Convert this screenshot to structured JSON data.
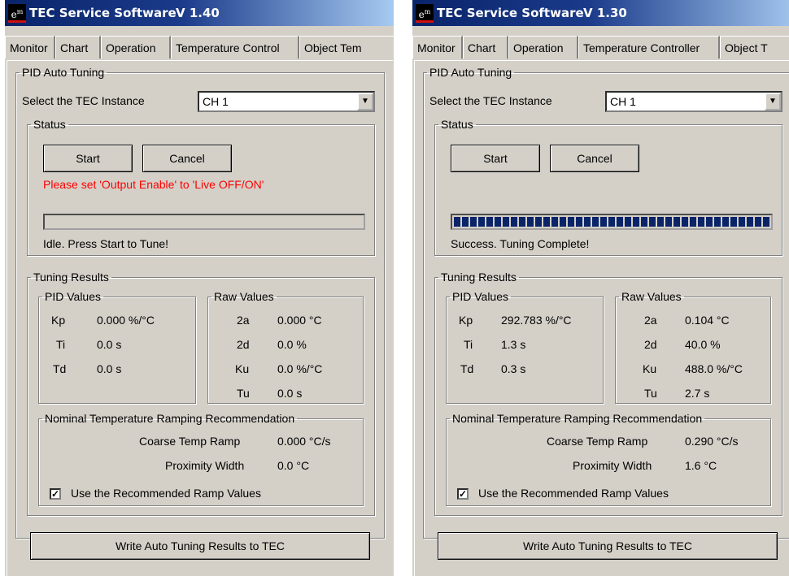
{
  "windows": [
    {
      "title": "TEC Service Software",
      "version": "V 1.40",
      "tabs": [
        "Monitor",
        "Chart",
        "Operation",
        "Temperature Control",
        "Object Tem"
      ],
      "pid_auto_tuning": "PID Auto Tuning",
      "select_label": "Select the TEC Instance",
      "instance_value": "CH 1",
      "status_legend": "Status",
      "start_label": "Start",
      "cancel_label": "Cancel",
      "warning": "Please set 'Output Enable' to 'Live OFF/ON'",
      "progress": 0,
      "status_message": "Idle. Press Start to Tune!",
      "tuning_results": "Tuning Results",
      "pid_values_legend": "PID Values",
      "pid": {
        "kp_label": "Kp",
        "kp_value": "0.000 %/°C",
        "ti_label": "Ti",
        "ti_value": "0.0 s",
        "td_label": "Td",
        "td_value": "0.0 s"
      },
      "raw_values_legend": "Raw Values",
      "raw": {
        "a2_label": "2a",
        "a2_value": "0.000 °C",
        "d2_label": "2d",
        "d2_value": "0.0 %",
        "ku_label": "Ku",
        "ku_value": "0.0 %/°C",
        "tu_label": "Tu",
        "tu_value": "0.0 s"
      },
      "ramp_legend": "Nominal Temperature Ramping Recommendation",
      "coarse_label": "Coarse Temp Ramp",
      "coarse_value": "0.000 °C/s",
      "proximity_label": "Proximity Width",
      "proximity_value": "0.0 °C",
      "use_recommended": "Use the Recommended Ramp Values",
      "use_checked": "✓",
      "write_button": "Write Auto Tuning Results to TEC"
    },
    {
      "title": "TEC Service Software",
      "version": "V 1.30",
      "tabs": [
        "Monitor",
        "Chart",
        "Operation",
        "Temperature Controller",
        "Object T"
      ],
      "pid_auto_tuning": "PID Auto Tuning",
      "select_label": "Select the TEC Instance",
      "instance_value": "CH 1",
      "status_legend": "Status",
      "start_label": "Start",
      "cancel_label": "Cancel",
      "warning": "",
      "progress": 1.0,
      "status_message": "Success. Tuning Complete!",
      "tuning_results": "Tuning Results",
      "pid_values_legend": "PID Values",
      "pid": {
        "kp_label": "Kp",
        "kp_value": "292.783 %/°C",
        "ti_label": "Ti",
        "ti_value": "1.3 s",
        "td_label": "Td",
        "td_value": "0.3 s"
      },
      "raw_values_legend": "Raw Values",
      "raw": {
        "a2_label": "2a",
        "a2_value": "0.104 °C",
        "d2_label": "2d",
        "d2_value": "40.0 %",
        "ku_label": "Ku",
        "ku_value": "488.0 %/°C",
        "tu_label": "Tu",
        "tu_value": "2.7 s"
      },
      "ramp_legend": "Nominal Temperature Ramping Recommendation",
      "coarse_label": "Coarse Temp Ramp",
      "coarse_value": "0.290 °C/s",
      "proximity_label": "Proximity Width",
      "proximity_value": "1.6 °C",
      "use_recommended": "Use the Recommended Ramp Values",
      "use_checked": "✓",
      "write_button": "Write Auto Tuning Results to TEC"
    }
  ],
  "logo_text": "e",
  "logo_sup": "m",
  "colors": {
    "titlebar": "#0a246a",
    "face": "#d4d0c8",
    "warning": "#ff0000",
    "progress_fill": "#0a246a"
  }
}
